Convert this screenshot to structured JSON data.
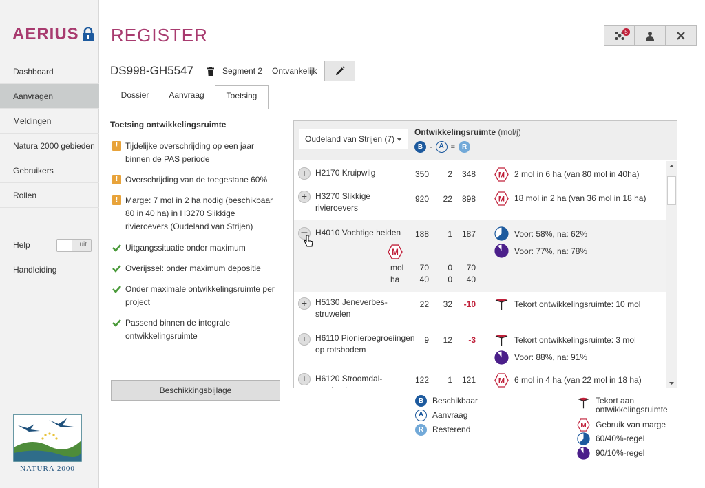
{
  "app": {
    "logo": "AERIUS",
    "title": "REGISTER"
  },
  "nav": {
    "items": [
      {
        "label": "Dashboard",
        "active": false
      },
      {
        "label": "Aanvragen",
        "active": true
      },
      {
        "label": "Meldingen",
        "active": false
      },
      {
        "label": "Natura 2000 gebieden",
        "active": false
      },
      {
        "label": "Gebruikers",
        "active": false
      },
      {
        "label": "Rollen",
        "active": false
      }
    ],
    "help_label": "Help",
    "help_toggle": "uit",
    "manual_label": "Handleiding",
    "natura_logo_text": "NATURA 2000"
  },
  "header": {
    "notification_count": "5"
  },
  "dossier": {
    "id": "DS998-GH5547",
    "segment": "Segment 2",
    "status": "Ontvankelijk"
  },
  "tabs": [
    {
      "label": "Dossier",
      "active": false
    },
    {
      "label": "Aanvraag",
      "active": false
    },
    {
      "label": "Toetsing",
      "active": true
    }
  ],
  "checks": {
    "title": "Toetsing ontwikkelingsruimte",
    "items": [
      {
        "type": "warning",
        "text": "Tijdelijke overschrijding op een jaar binnen de PAS periode"
      },
      {
        "type": "warning",
        "text": "Overschrijding van de toegestane 60%"
      },
      {
        "type": "warning",
        "text": "Marge: 7 mol in 2 ha nodig (beschikbaar 80 in 40 ha) in H3270 Slikkige rivieroevers (Oudeland van Strijen)"
      },
      {
        "type": "ok",
        "text": "Uitgangssituatie onder maximum"
      },
      {
        "type": "ok",
        "text": "Overijssel: onder maximum depositie"
      },
      {
        "type": "ok",
        "text": "Onder maximale ontwikkelingsruimte per project"
      },
      {
        "type": "ok",
        "text": "Passend binnen de integrale ontwikkelingsruimte"
      }
    ],
    "button": "Beschikkingsbijlage"
  },
  "panel": {
    "area_select": "Oudeland van Strijen (7)",
    "title": "Ontwikkelingsruimte",
    "unit": "(mol/j)",
    "formula": {
      "b": "B",
      "minus": "-",
      "a": "A",
      "equals": "=",
      "r": "R"
    },
    "rows": [
      {
        "name": "H2170 Kruipwilg",
        "b": "350",
        "a": "2",
        "r": "348",
        "indicators": [
          {
            "icon": "marge-icon",
            "text": "2 mol in 6 ha (van 80 mol in 40ha)"
          }
        ]
      },
      {
        "name_l1": "H3270 Slikkige",
        "name_l2": "rivieroevers",
        "b": "920",
        "a": "22",
        "r": "898",
        "indicators": [
          {
            "icon": "marge-icon",
            "text": "18 mol in 2 ha (van 36 mol in 18 ha)"
          }
        ]
      },
      {
        "name": "H4010 Vochtige heiden",
        "b": "188",
        "a": "1",
        "r": "187",
        "indicators": [
          {
            "icon": "rule-60-40-icon",
            "text": "Voor: 58%, na: 62%"
          },
          {
            "icon": "rule-90-10-icon",
            "text": "Voor: 77%, na: 78%"
          }
        ],
        "detail": {
          "mol_label": "mol",
          "ha_label": "ha",
          "mol": [
            "70",
            "0",
            "70"
          ],
          "ha": [
            "40",
            "0",
            "40"
          ]
        }
      },
      {
        "name_l1": "H5130 Jeneverbes-",
        "name_l2": "struwelen",
        "b": "22",
        "a": "32",
        "r": "-10",
        "indicators": [
          {
            "icon": "shortage-icon",
            "text": "Tekort ontwikkelingsruimte: 10 mol"
          }
        ]
      },
      {
        "name_l1": "H6110 Pionierbegroeiingen",
        "name_l2": "op rotsbodem",
        "b": "9",
        "a": "12",
        "r": "-3",
        "indicators": [
          {
            "icon": "shortage-icon",
            "text": "Tekort ontwikkelingsruimte:  3 mol"
          },
          {
            "icon": "rule-90-10-icon",
            "text": "Voor: 88%, na: 91%"
          }
        ]
      },
      {
        "name_l1": "H6120 Stroomdal-",
        "name_l2": "graslanden",
        "b": "122",
        "a": "1",
        "r": "121",
        "indicators": [
          {
            "icon": "marge-icon",
            "text": "6 mol in 4 ha (van 22 mol in 18 ha)"
          }
        ]
      }
    ]
  },
  "legend": {
    "b": "Beschikbaar",
    "a": "Aanvraag",
    "r": "Resterend",
    "shortage_l1": "Tekort aan",
    "shortage_l2": "ontwikkelingsruimte",
    "marge": "Gebruik van marge",
    "rule60": "60/40%-regel",
    "rule90": "90/10%-regel"
  },
  "colors": {
    "brand": "#a83b6f",
    "warning": "#e8a33a",
    "ok": "#4a9a3a",
    "danger": "#c0203a",
    "rule_purple": "#4b1f8a",
    "rule_blue": "#1d5a9e"
  }
}
